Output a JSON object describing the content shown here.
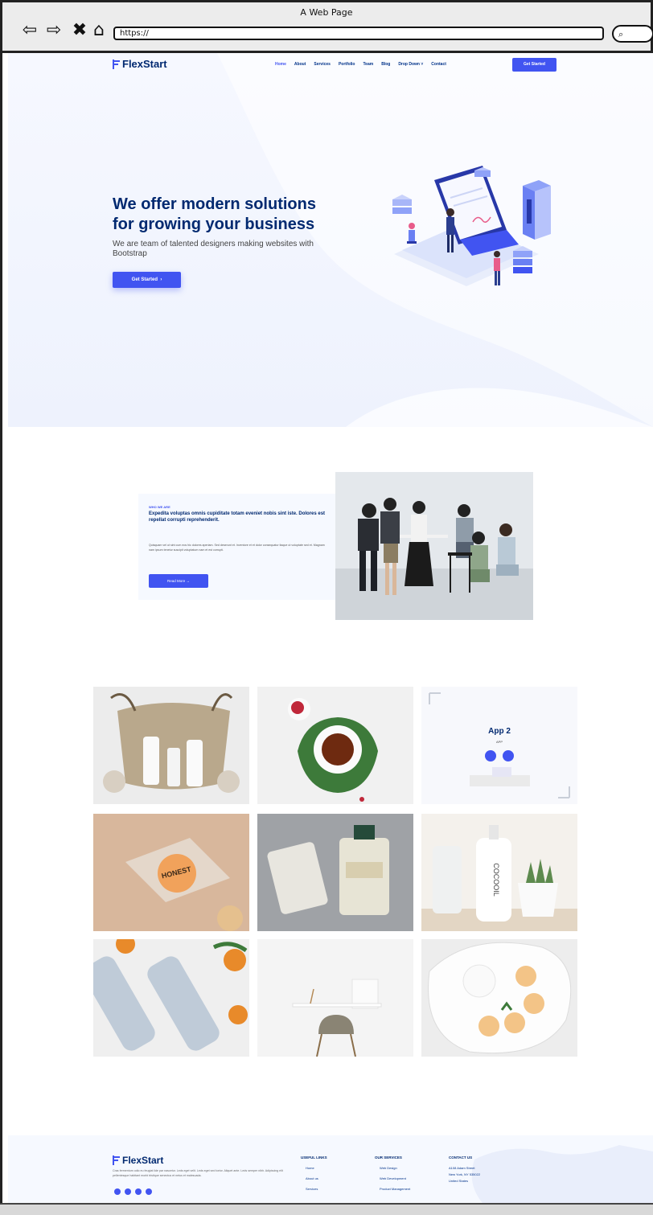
{
  "browser": {
    "window_title": "A Web Page",
    "url": "https://",
    "back_icon": "arrow-left-icon",
    "forward_icon": "arrow-right-icon",
    "close_icon": "x-icon",
    "home_icon": "home-icon",
    "search_icon": "magnifier-icon"
  },
  "header": {
    "logo": "FlexStart",
    "menu": [
      "Home",
      "About",
      "Services",
      "Portfolio",
      "Team",
      "Blog",
      "Drop Down",
      "Contact"
    ],
    "active_index": 0,
    "cta": "Get Started"
  },
  "hero": {
    "title": "We offer modern solutions for growing your business",
    "subtitle": "We are team of talented designers making websites with Bootstrap",
    "button": "Get Started"
  },
  "about": {
    "eyebrow": "WHO WE ARE",
    "title": "Expedita voluptas omnis cupiditate totam eveniet nobis sint iste. Dolores est repellat corrupti reprehenderit.",
    "text": "Quisquam vel ut sint cum eos hic dolores aperiam. Sed deserunt et. Inventore et et dolor consequatur itaque ut voluptate sed et. Magnam nam ipsum tenetur suscipit voluptatum nam et est corrupti.",
    "button": "Read More →"
  },
  "portfolio": {
    "app_tile": {
      "title": "App 2",
      "subtitle": "APP"
    }
  },
  "footer": {
    "logo": "FlexStart",
    "about_text": "Cras fermentum odio eu feugiat lide par nascetur. Leds eget velit. Leds eget sed tortor. Aliquet ante. Leds semper nibh. Adipiscing elit pellentesque habitant morbi tristique senectus et netus et malesuada.",
    "useful_links_title": "USEFUL LINKS",
    "useful_links": [
      "Home",
      "About us",
      "Services"
    ],
    "services_title": "OUR SERVICES",
    "services": [
      "Web Design",
      "Web Development",
      "Product Management"
    ],
    "contact_title": "CONTACT US",
    "contact_lines": [
      "A108 Adam Street",
      "New York, NY 535022",
      "United States"
    ]
  },
  "colors": {
    "accent": "#4154f1",
    "heading": "#012970",
    "hero_bg": "#f6f8ff"
  }
}
